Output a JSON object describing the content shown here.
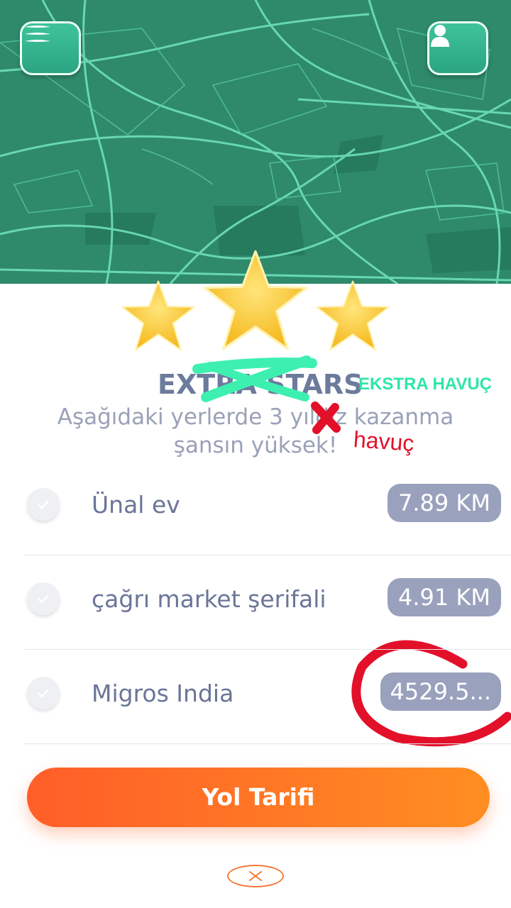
{
  "map": {
    "background_color": "#2e8a6b",
    "road_color": "#6fe0bb"
  },
  "header": {
    "menu_icon": "hamburger-icon",
    "profile_icon": "user-icon"
  },
  "rating": {
    "stars_earned": 3,
    "stars_total": 3,
    "star_color": "#f7c531"
  },
  "reward": {
    "title": "EXTRA STARS",
    "title_annotation": "EKSTRA HAVUÇ",
    "subtitle_line1": "Aşağıdaki yerlerde 3 yıldız kazanma",
    "subtitle_line2": "şansın yüksek!",
    "subtitle_annotation": "havuç"
  },
  "places": [
    {
      "name": "Ünal ev",
      "distance": "7.89 KM"
    },
    {
      "name": "çağrı market şerifali",
      "distance": "4.91 KM"
    },
    {
      "name": "Migros India",
      "distance": "4529.5..."
    }
  ],
  "actions": {
    "directions_label": "Yol Tarifi",
    "close_icon": "close-icon",
    "primary_color": "#ff7a25"
  }
}
